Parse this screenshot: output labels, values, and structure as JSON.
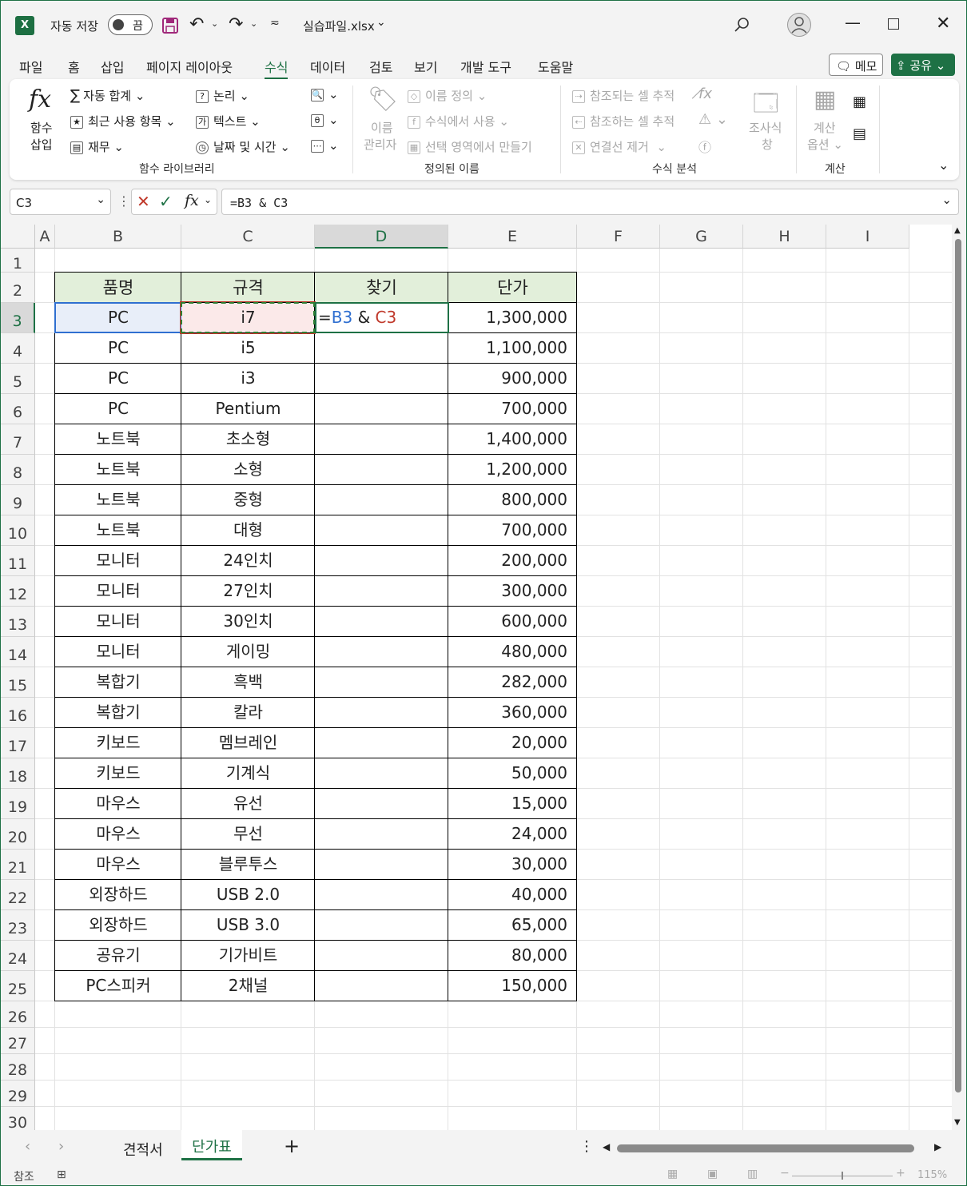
{
  "titlebar": {
    "autosave_label": "자동 저장",
    "autosave_state": "끔",
    "filename": "실습파일.xlsx"
  },
  "menu": [
    "파일",
    "홈",
    "삽입",
    "페이지 레이아웃",
    "수식",
    "데이터",
    "검토",
    "보기",
    "개발 도구",
    "도움말"
  ],
  "menu_active": "수식",
  "memo_button": "메모",
  "share_button": "공유",
  "ribbon": {
    "insert_func_line1": "함수",
    "insert_func_line2": "삽입",
    "autosum": "자동 합계",
    "recent": "최근 사용 항목",
    "finance": "재무",
    "logic": "논리",
    "text": "텍스트",
    "datetime": "날짜 및 시간",
    "group_library": "함수 라이브러리",
    "name_mgr_line1": "이름",
    "name_mgr_line2": "관리자",
    "define_name": "이름 정의",
    "use_in_formula": "수식에서 사용",
    "create_from_sel": "선택 영역에서 만들기",
    "group_names": "정의된 이름",
    "trace_precedents": "참조되는 셀 추적",
    "trace_dependents": "참조하는 셀 추적",
    "remove_arrows": "연결선 제거",
    "watch_line1": "조사식",
    "watch_line2": "창",
    "group_audit": "수식 분석",
    "calc_opt_line1": "계산",
    "calc_opt_line2": "옵션",
    "group_calc": "계산"
  },
  "namebox": "C3",
  "formula": "=B3 & C3",
  "columns": [
    "A",
    "B",
    "C",
    "D",
    "E",
    "F",
    "G",
    "H",
    "I"
  ],
  "selected_column": "D",
  "rows": [
    "1",
    "2",
    "3",
    "4",
    "5",
    "6",
    "7",
    "8",
    "9",
    "10",
    "11",
    "12",
    "13",
    "14",
    "15",
    "16",
    "17",
    "18",
    "19",
    "20",
    "21",
    "22",
    "23",
    "24",
    "25",
    "26",
    "27",
    "28",
    "29",
    "30"
  ],
  "selected_row": "3",
  "table": {
    "headers": [
      "품명",
      "규격",
      "찾기",
      "단가"
    ],
    "rows": [
      [
        "PC",
        "i7",
        "",
        "1,300,000"
      ],
      [
        "PC",
        "i5",
        "",
        "1,100,000"
      ],
      [
        "PC",
        "i3",
        "",
        "900,000"
      ],
      [
        "PC",
        "Pentium",
        "",
        "700,000"
      ],
      [
        "노트북",
        "초소형",
        "",
        "1,400,000"
      ],
      [
        "노트북",
        "소형",
        "",
        "1,200,000"
      ],
      [
        "노트북",
        "중형",
        "",
        "800,000"
      ],
      [
        "노트북",
        "대형",
        "",
        "700,000"
      ],
      [
        "모니터",
        "24인치",
        "",
        "200,000"
      ],
      [
        "모니터",
        "27인치",
        "",
        "300,000"
      ],
      [
        "모니터",
        "30인치",
        "",
        "600,000"
      ],
      [
        "모니터",
        "게이밍",
        "",
        "480,000"
      ],
      [
        "복합기",
        "흑백",
        "",
        "282,000"
      ],
      [
        "복합기",
        "칼라",
        "",
        "360,000"
      ],
      [
        "키보드",
        "멤브레인",
        "",
        "20,000"
      ],
      [
        "키보드",
        "기계식",
        "",
        "50,000"
      ],
      [
        "마우스",
        "유선",
        "",
        "15,000"
      ],
      [
        "마우스",
        "무선",
        "",
        "24,000"
      ],
      [
        "마우스",
        "블루투스",
        "",
        "30,000"
      ],
      [
        "외장하드",
        "USB 2.0",
        "",
        "40,000"
      ],
      [
        "외장하드",
        "USB 3.0",
        "",
        "65,000"
      ],
      [
        "공유기",
        "기가비트",
        "",
        "80,000"
      ],
      [
        "PC스피커",
        "2채널",
        "",
        "150,000"
      ]
    ]
  },
  "edit_cell": {
    "eq": "=",
    "ref1": "B3",
    "amp": " & ",
    "ref2": "C3"
  },
  "sheets": [
    "견적서",
    "단가표"
  ],
  "active_sheet": "단가표",
  "status_left": "참조",
  "zoom": "115%",
  "colors": {
    "accent": "#1e7145",
    "header_fill": "#e2efda",
    "ref1": "#2f6fd0",
    "ref2": "#c0392b"
  }
}
